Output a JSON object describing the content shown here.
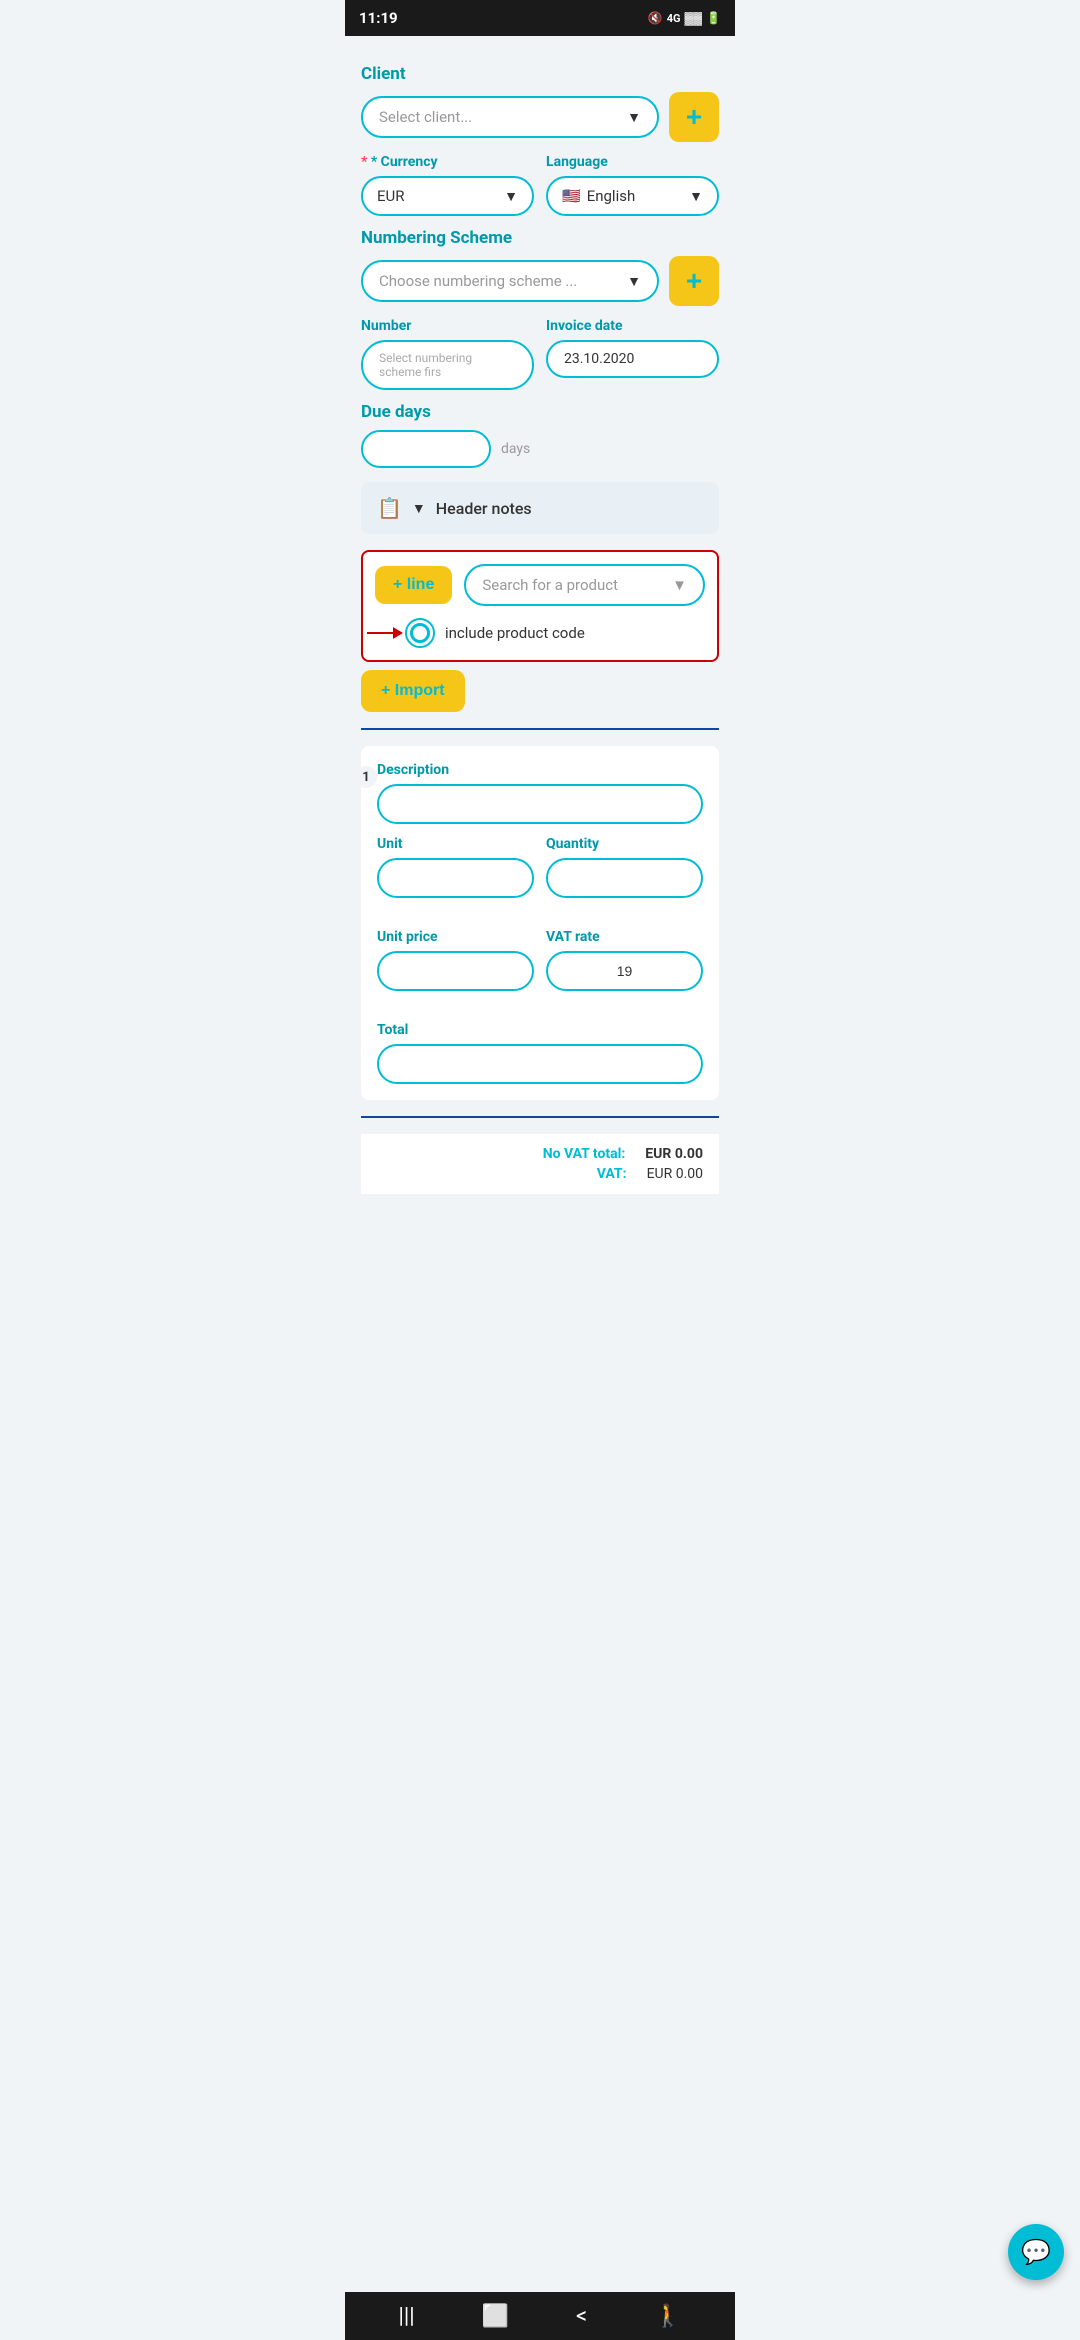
{
  "statusBar": {
    "time": "11:19",
    "icons": "🔇 4G ▓▓ 🔋"
  },
  "form": {
    "clientLabel": "Client",
    "clientPlaceholder": "Select client...",
    "currencyLabel": "* Currency",
    "currencyValue": "EUR",
    "languageLabel": "Language",
    "languageValue": "English",
    "languageFlag": "🇺🇸",
    "numberingSchemeLabel": "Numbering Scheme",
    "numberingSchemeValue": "Choose numbering scheme ...",
    "numberLabel": "Number",
    "numberPlaceholder": "Select numbering scheme firs",
    "invoiceDateLabel": "Invoice date",
    "invoiceDateValue": "23.10.2020",
    "dueDaysLabel": "Due days",
    "dueDaysValue": "",
    "dueDaysSuffix": "days",
    "headerNotesLabel": "Header notes",
    "addLineLabel": "+ line",
    "searchProductPlaceholder": "Search for a product",
    "includeProductCodeLabel": "include product code",
    "importLabel": "+ Import",
    "descriptionLabel": "Description",
    "descriptionValue": "",
    "unitLabel": "Unit",
    "unitValue": "",
    "quantityLabel": "Quantity",
    "quantityValue": "",
    "unitPriceLabel": "Unit price",
    "unitPriceValue": "",
    "vatRateLabel": "VAT rate",
    "vatRateValue": "19",
    "totalLabel": "Total",
    "totalValue": "",
    "noVatTotalLabel": "No VAT total:",
    "noVatTotalValue": "EUR 0.00",
    "vatLabel": "VAT:",
    "vatValue": "EUR 0.00"
  },
  "nav": {
    "menu": "|||",
    "home": "⬜",
    "back": "<",
    "profile": "🚶"
  }
}
